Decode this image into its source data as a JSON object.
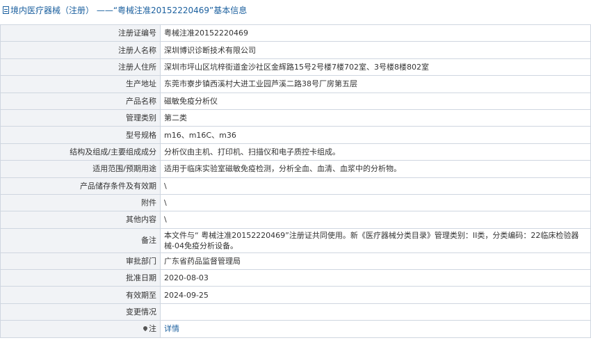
{
  "header": {
    "title": "境内医疗器械（注册） ——“粤械注准20152220469”基本信息"
  },
  "rows": [
    {
      "label": "注册证编号",
      "value": "粤械注准20152220469"
    },
    {
      "label": "注册人名称",
      "value": "深圳博识诊断技术有限公司"
    },
    {
      "label": "注册人住所",
      "value": "深圳市坪山区坑梓街道金沙社区金辉路15号2号楼7楼702室、3号楼8楼802室"
    },
    {
      "label": "生产地址",
      "value": "东莞市寮步镇西溪村大进工业园芦溪二路38号厂房第五层"
    },
    {
      "label": "产品名称",
      "value": "磁敏免疫分析仪"
    },
    {
      "label": "管理类别",
      "value": "第二类"
    },
    {
      "label": "型号规格",
      "value": "m16、m16C、m36"
    },
    {
      "label": "结构及组成/主要组成成分",
      "value": "分析仪由主机、打印机、扫描仪和电子质控卡组成。"
    },
    {
      "label": "适用范围/预期用途",
      "value": "适用于临床实验室磁敏免疫检测，分析全血、血清、血浆中的分析物。"
    },
    {
      "label": "产品储存条件及有效期",
      "value": "\\"
    },
    {
      "label": "附件",
      "value": "\\"
    },
    {
      "label": "其他内容",
      "value": "\\"
    },
    {
      "label": "备注",
      "value": "本文件与“ 粤械注准20152220469”注册证共同使用。新《医疗器械分类目录》管理类别：II类，分类编码：22临床检验器械-04免疫分析设备。"
    },
    {
      "label": "审批部门",
      "value": "广东省药品监督管理局"
    },
    {
      "label": "批准日期",
      "value": "2020-08-03"
    },
    {
      "label": "有效期至",
      "value": "2024-09-25"
    },
    {
      "label": "变更情况",
      "value": ""
    }
  ],
  "note": {
    "label": "注",
    "link": "详情"
  }
}
